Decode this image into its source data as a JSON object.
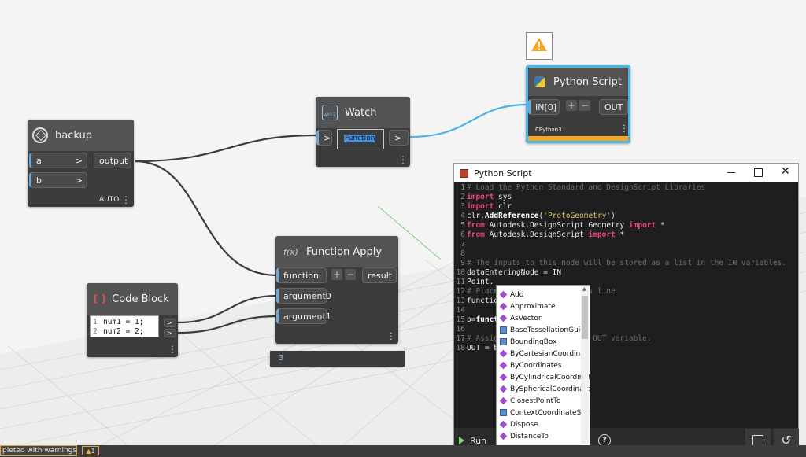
{
  "colors": {
    "wire": "#3c3c3c",
    "blue_wire": "#4ab5e3",
    "node_bg": "#3c3c3c",
    "header": "#535353",
    "selected": "#4ab5e3",
    "warning": "#f5a623",
    "keyword": "#e8467c"
  },
  "nodes": {
    "backup": {
      "title": "backup",
      "inputs": [
        "a",
        "b"
      ],
      "output": "output",
      "lacing": "AUTO",
      "icon": "custom-node-icon"
    },
    "watch": {
      "title": "Watch",
      "input": ">",
      "value": "Function",
      "output": ">"
    },
    "python": {
      "title": "Python Script",
      "input": "IN[0]",
      "plus": "+",
      "minus": "−",
      "output": "OUT",
      "engine": "CPython3",
      "warning_icon": "warning-icon"
    },
    "function_apply": {
      "title": "Function Apply",
      "inputs": [
        "function",
        "argument0",
        "argument1"
      ],
      "plus": "+",
      "minus": "−",
      "output": "result",
      "preview": "3"
    },
    "code_block": {
      "title": "Code Block",
      "lines": [
        "num1 = 1;",
        "num2 = 2;"
      ],
      "line_numbers": [
        "1",
        "2"
      ],
      "outputs": [
        ">",
        ">"
      ]
    }
  },
  "python_editor": {
    "window_title": "Python Script",
    "line_numbers": [
      "1",
      "2",
      "3",
      "4",
      "5",
      "6",
      "7",
      "8",
      "9",
      "10",
      "11",
      "12",
      "13",
      "14",
      "15",
      "16",
      "17",
      "18"
    ],
    "run_label": "Run",
    "autocomplete": [
      "Add",
      "Approximate",
      "AsVector",
      "BaseTessellationGuid",
      "BoundingBox",
      "ByCartesianCoordinat",
      "ByCoordinates",
      "ByCylindricalCoordinat",
      "BySphericalCoordinate",
      "ClosestPointTo",
      "ContextCoordinateSyst",
      "Dispose",
      "DistanceTo"
    ],
    "autocomplete_kinds": [
      "method",
      "method",
      "method",
      "property",
      "property",
      "method",
      "method",
      "method",
      "method",
      "method",
      "property",
      "method",
      "method"
    ]
  },
  "status": {
    "text": "pleted with warnings",
    "badge": "1"
  }
}
